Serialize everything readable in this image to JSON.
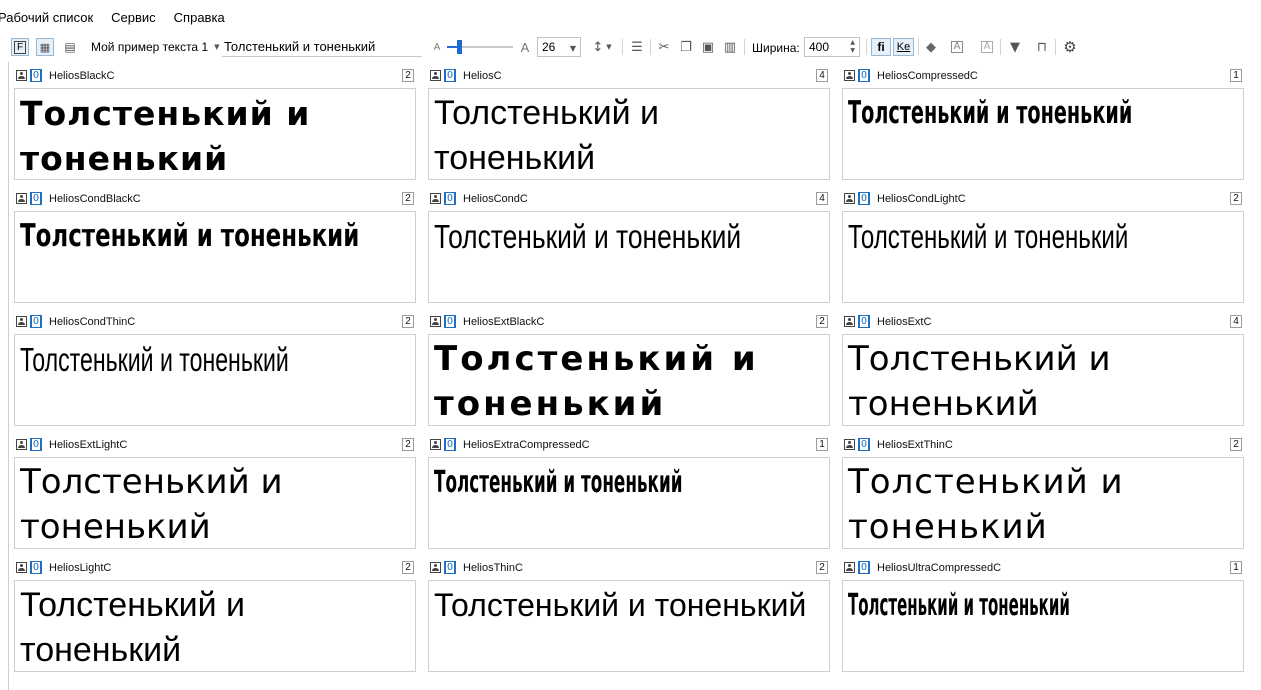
{
  "menu": {
    "items": [
      "Рабочий список",
      "Сервис",
      "Справка"
    ]
  },
  "toolbar": {
    "sample_name": "Мой пример текста 1",
    "sample_text_value": "Толстенький и тоненький",
    "small_a": "A",
    "big_a": "A",
    "font_size": "26",
    "font_size_slider_fraction": 0.15,
    "width_label": "Ширина:",
    "width_value": "400",
    "mode_f": "F",
    "ligature_btn": "fi",
    "kerning_btn": "Ke"
  },
  "sample_text": "Толстенький и тоненький",
  "fonts": [
    {
      "name": "HeliosBlackC",
      "count": "2",
      "style": "s-black"
    },
    {
      "name": "HeliosC",
      "count": "4",
      "style": "s-reg"
    },
    {
      "name": "HeliosCompressedC",
      "count": "1",
      "style": "s-comp"
    },
    {
      "name": "HeliosCondBlackC",
      "count": "2",
      "style": "s-condblack"
    },
    {
      "name": "HeliosCondC",
      "count": "4",
      "style": "s-cond"
    },
    {
      "name": "HeliosCondLightC",
      "count": "2",
      "style": "s-condlight"
    },
    {
      "name": "HeliosCondThinC",
      "count": "2",
      "style": "s-condthin"
    },
    {
      "name": "HeliosExtBlackC",
      "count": "2",
      "style": "s-extblack"
    },
    {
      "name": "HeliosExtC",
      "count": "4",
      "style": "s-ext"
    },
    {
      "name": "HeliosExtLightC",
      "count": "2",
      "style": "s-extlight"
    },
    {
      "name": "HeliosExtraCompressedC",
      "count": "1",
      "style": "s-xcomp"
    },
    {
      "name": "HeliosExtThinC",
      "count": "2",
      "style": "s-extthin"
    },
    {
      "name": "HeliosLightC",
      "count": "2",
      "style": "s-light"
    },
    {
      "name": "HeliosThinC",
      "count": "2",
      "style": "s-thin"
    },
    {
      "name": "HeliosUltraCompressedC",
      "count": "1",
      "style": "s-ucomp"
    }
  ]
}
